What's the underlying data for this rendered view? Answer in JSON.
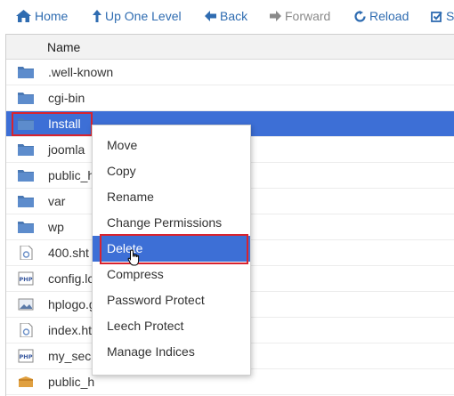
{
  "toolbar": {
    "home_label": "Home",
    "up_label": "Up One Level",
    "back_label": "Back",
    "forward_label": "Forward",
    "reload_label": "Reload",
    "select_label": "S"
  },
  "table": {
    "col_name": "Name",
    "rows": [
      {
        "name": ".well-known",
        "icon": "folder-icon"
      },
      {
        "name": "cgi-bin",
        "icon": "folder-icon"
      },
      {
        "name": "Install",
        "icon": "folder-icon",
        "selected": true
      },
      {
        "name": "joomla",
        "icon": "folder-icon"
      },
      {
        "name": "public_h",
        "icon": "folder-icon"
      },
      {
        "name": "var",
        "icon": "folder-icon"
      },
      {
        "name": "wp",
        "icon": "folder-icon"
      },
      {
        "name": "400.sht",
        "icon": "document-icon"
      },
      {
        "name": "config.lc",
        "icon": "php-file-icon"
      },
      {
        "name": "hplogo.g",
        "icon": "image-file-icon"
      },
      {
        "name": "index.ht",
        "icon": "document-icon"
      },
      {
        "name": "my_sec",
        "icon": "php-file-icon"
      },
      {
        "name": "public_h",
        "icon": "package-icon"
      }
    ]
  },
  "context_menu": {
    "items": [
      "Move",
      "Copy",
      "Rename",
      "Change Permissions",
      "Delete",
      "Compress",
      "Password Protect",
      "Leech Protect",
      "Manage Indices"
    ],
    "active_item": "Delete"
  },
  "colors": {
    "link_blue": "#2f6cb1",
    "selection_blue": "#3d6fd6",
    "highlight_red": "#d9232e",
    "folder_blue": "#4a78b4"
  }
}
